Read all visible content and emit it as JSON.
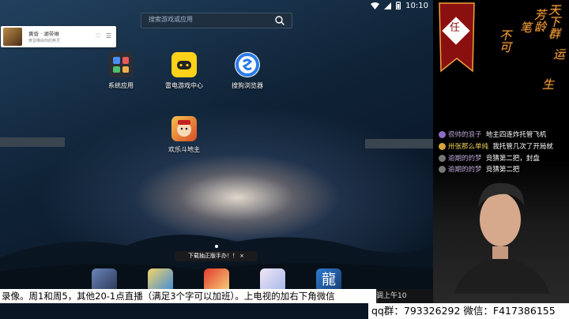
{
  "status": {
    "time": "10:10"
  },
  "search": {
    "placeholder": "搜索游戏或应用"
  },
  "notification": {
    "title": "黄昏 · 湖带琳",
    "subtitle": "黄昏琳由你的英灵",
    "like_icon": "heart-outline-icon",
    "more_icon": "menu-icon"
  },
  "apps": [
    {
      "label": "系统应用",
      "icon": "system-apps-folder-icon"
    },
    {
      "label": "雷电游戏中心",
      "icon": "gamepad-icon"
    },
    {
      "label": "搜狗浏览器",
      "icon": "sogou-browser-icon"
    },
    {
      "label": "欢乐斗地主",
      "icon": "doudizhu-game-icon"
    }
  ],
  "toast": {
    "text": "下载抽正版手办！！ ×"
  },
  "dock": [
    {
      "icon": "game-icon-1"
    },
    {
      "icon": "game-icon-2"
    },
    {
      "icon": "one-piece-game-icon"
    },
    {
      "icon": "anime-game-icon"
    },
    {
      "icon": "long-game-icon",
      "label": "龍"
    }
  ],
  "flag": {
    "text": "任"
  },
  "calligraphy": {
    "col1": "天下群",
    "col2": "芳龄",
    "col3": "笔",
    "col4": "不可",
    "col5": "运",
    "col6": "生"
  },
  "chat": [
    {
      "name": "很帅的浪子",
      "msg": "地主四连炸托管飞机"
    },
    {
      "name": "卅张那么单纯",
      "msg": "我托管几次了开局就"
    },
    {
      "name": "逾期的的梦",
      "msg": "竞猜第二把，封盘"
    },
    {
      "name": "逾期的的梦",
      "msg": "竞猜第二把"
    }
  ],
  "ticker": {
    "text": "录像。周1和周5，其他20-1点直播（满足3个字可以加班）。上电视的加右下角微信",
    "tail": "调上午10"
  },
  "contact": {
    "text": "qq群：793326292 微信：F417386155"
  },
  "colors": {
    "ticker_bg": "#ffffff",
    "calligraphy": "#f0a23c",
    "chat_name": "#b7a9d6"
  }
}
